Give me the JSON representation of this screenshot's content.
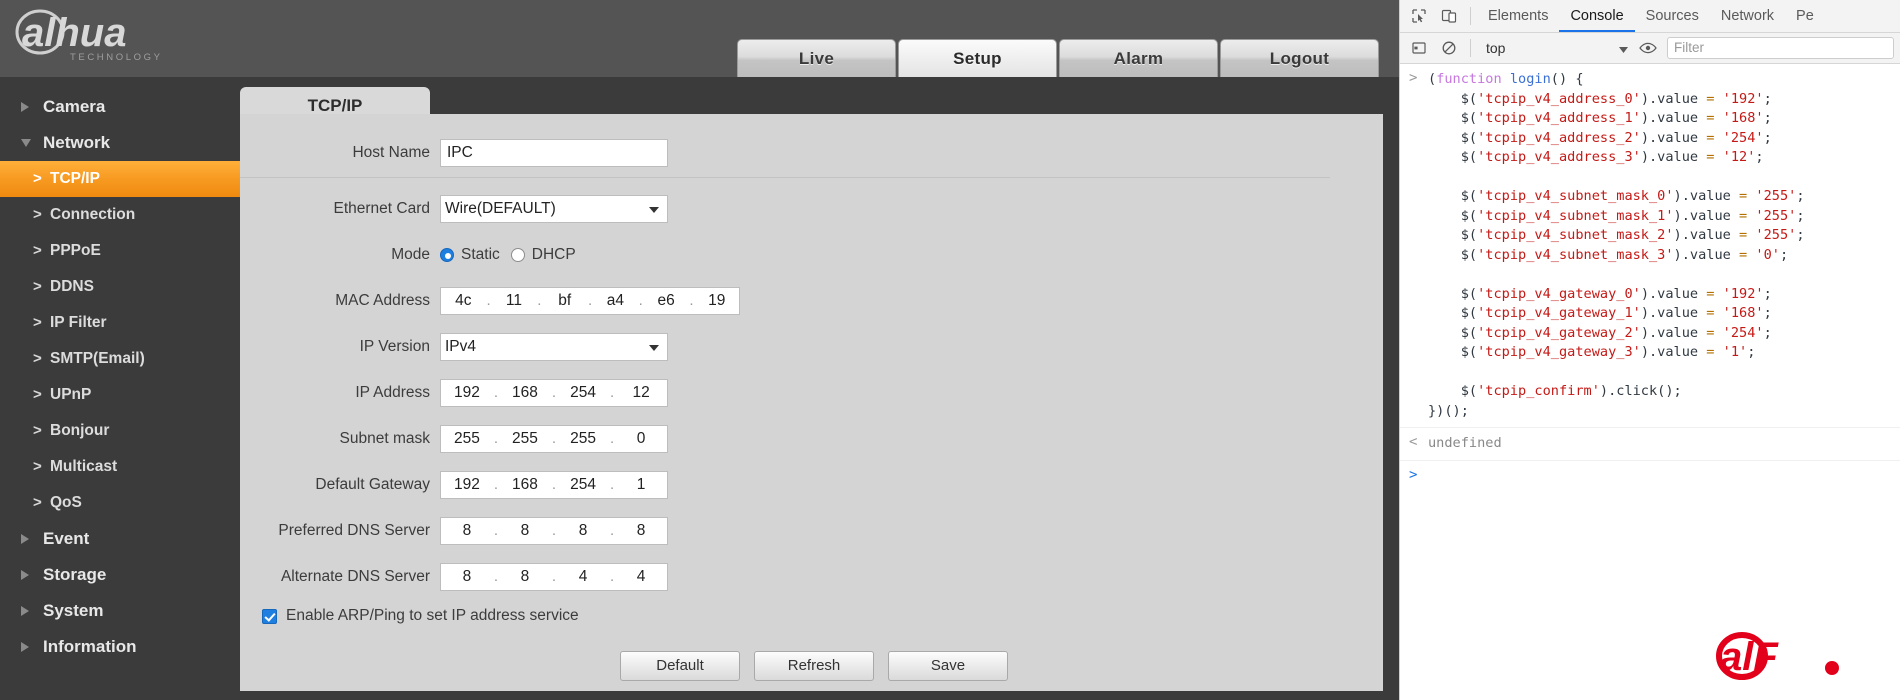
{
  "brand": {
    "logo_text": "alhua",
    "logo_sub": "TECHNOLOGY"
  },
  "header": {
    "tabs": [
      {
        "label": "Live",
        "active": false
      },
      {
        "label": "Setup",
        "active": true
      },
      {
        "label": "Alarm",
        "active": false
      },
      {
        "label": "Logout",
        "active": false
      }
    ]
  },
  "sidebar": {
    "groups": [
      {
        "label": "Camera",
        "expanded": false
      },
      {
        "label": "Network",
        "expanded": true
      },
      {
        "label": "Event",
        "expanded": false
      },
      {
        "label": "Storage",
        "expanded": false
      },
      {
        "label": "System",
        "expanded": false
      },
      {
        "label": "Information",
        "expanded": false
      }
    ],
    "network_items": [
      {
        "label": "TCP/IP",
        "active": true
      },
      {
        "label": "Connection",
        "active": false
      },
      {
        "label": "PPPoE",
        "active": false
      },
      {
        "label": "DDNS",
        "active": false
      },
      {
        "label": "IP Filter",
        "active": false
      },
      {
        "label": "SMTP(Email)",
        "active": false
      },
      {
        "label": "UPnP",
        "active": false
      },
      {
        "label": "Bonjour",
        "active": false
      },
      {
        "label": "Multicast",
        "active": false
      },
      {
        "label": "QoS",
        "active": false
      }
    ]
  },
  "panel": {
    "tab_label": "TCP/IP",
    "labels": {
      "host_name": "Host Name",
      "ethernet_card": "Ethernet Card",
      "mode": "Mode",
      "mac_address": "MAC Address",
      "ip_version": "IP Version",
      "ip_address": "IP Address",
      "subnet_mask": "Subnet mask",
      "default_gateway": "Default Gateway",
      "preferred_dns": "Preferred DNS Server",
      "alternate_dns": "Alternate DNS Server"
    },
    "values": {
      "host_name": "IPC",
      "ethernet_card": "Wire(DEFAULT)",
      "ip_version": "IPv4",
      "mac_address": [
        "4c",
        "11",
        "bf",
        "a4",
        "e6",
        "19"
      ],
      "ip_address": [
        "192",
        "168",
        "254",
        "12"
      ],
      "subnet_mask": [
        "255",
        "255",
        "255",
        "0"
      ],
      "default_gateway": [
        "192",
        "168",
        "254",
        "1"
      ],
      "preferred_dns": [
        "8",
        "8",
        "8",
        "8"
      ],
      "alternate_dns": [
        "8",
        "8",
        "4",
        "4"
      ]
    },
    "mode": {
      "static_label": "Static",
      "dhcp_label": "DHCP",
      "selected": "Static"
    },
    "arp_ping": {
      "label": "Enable ARP/Ping to set IP address service",
      "checked": true
    },
    "buttons": [
      {
        "label": "Default"
      },
      {
        "label": "Refresh"
      },
      {
        "label": "Save"
      }
    ]
  },
  "devtools": {
    "toolbar_icons": [
      "inspect-element-icon",
      "device-toolbar-icon"
    ],
    "tabs": [
      {
        "label": "Elements",
        "active": false
      },
      {
        "label": "Console",
        "active": true
      },
      {
        "label": "Sources",
        "active": false
      },
      {
        "label": "Network",
        "active": false
      },
      {
        "label": "Pe",
        "active": false
      }
    ],
    "subbar": {
      "sidebar_icon": "console-sidebar-icon",
      "clear_icon": "clear-console-icon",
      "context": "top",
      "eye_icon": "live-expression-icon",
      "filter_placeholder": "Filter"
    },
    "console": {
      "input_prompt": ">",
      "output_prompt": "<",
      "result": "undefined",
      "code_lines": [
        {
          "indent": 0,
          "tokens": [
            {
              "t": "(",
              "c": "plain"
            },
            {
              "t": "function ",
              "c": "kw"
            },
            {
              "t": "login",
              "c": "fn"
            },
            {
              "t": "() {",
              "c": "plain"
            }
          ]
        },
        {
          "indent": 1,
          "tokens": [
            {
              "t": "$(",
              "c": "plain"
            },
            {
              "t": "'tcpip_v4_address_0'",
              "c": "str"
            },
            {
              "t": ").value ",
              "c": "plain"
            },
            {
              "t": "=",
              "c": "op"
            },
            {
              "t": " ",
              "c": "plain"
            },
            {
              "t": "'192'",
              "c": "str"
            },
            {
              "t": ";",
              "c": "plain"
            }
          ]
        },
        {
          "indent": 1,
          "tokens": [
            {
              "t": "$(",
              "c": "plain"
            },
            {
              "t": "'tcpip_v4_address_1'",
              "c": "str"
            },
            {
              "t": ").value ",
              "c": "plain"
            },
            {
              "t": "=",
              "c": "op"
            },
            {
              "t": " ",
              "c": "plain"
            },
            {
              "t": "'168'",
              "c": "str"
            },
            {
              "t": ";",
              "c": "plain"
            }
          ]
        },
        {
          "indent": 1,
          "tokens": [
            {
              "t": "$(",
              "c": "plain"
            },
            {
              "t": "'tcpip_v4_address_2'",
              "c": "str"
            },
            {
              "t": ").value ",
              "c": "plain"
            },
            {
              "t": "=",
              "c": "op"
            },
            {
              "t": " ",
              "c": "plain"
            },
            {
              "t": "'254'",
              "c": "str"
            },
            {
              "t": ";",
              "c": "plain"
            }
          ]
        },
        {
          "indent": 1,
          "tokens": [
            {
              "t": "$(",
              "c": "plain"
            },
            {
              "t": "'tcpip_v4_address_3'",
              "c": "str"
            },
            {
              "t": ").value ",
              "c": "plain"
            },
            {
              "t": "=",
              "c": "op"
            },
            {
              "t": " ",
              "c": "plain"
            },
            {
              "t": "'12'",
              "c": "str"
            },
            {
              "t": ";",
              "c": "plain"
            }
          ]
        },
        {
          "indent": 0,
          "tokens": [
            {
              "t": "",
              "c": "plain"
            }
          ]
        },
        {
          "indent": 1,
          "tokens": [
            {
              "t": "$(",
              "c": "plain"
            },
            {
              "t": "'tcpip_v4_subnet_mask_0'",
              "c": "str"
            },
            {
              "t": ").value ",
              "c": "plain"
            },
            {
              "t": "=",
              "c": "op"
            },
            {
              "t": " ",
              "c": "plain"
            },
            {
              "t": "'255'",
              "c": "str"
            },
            {
              "t": ";",
              "c": "plain"
            }
          ]
        },
        {
          "indent": 1,
          "tokens": [
            {
              "t": "$(",
              "c": "plain"
            },
            {
              "t": "'tcpip_v4_subnet_mask_1'",
              "c": "str"
            },
            {
              "t": ").value ",
              "c": "plain"
            },
            {
              "t": "=",
              "c": "op"
            },
            {
              "t": " ",
              "c": "plain"
            },
            {
              "t": "'255'",
              "c": "str"
            },
            {
              "t": ";",
              "c": "plain"
            }
          ]
        },
        {
          "indent": 1,
          "tokens": [
            {
              "t": "$(",
              "c": "plain"
            },
            {
              "t": "'tcpip_v4_subnet_mask_2'",
              "c": "str"
            },
            {
              "t": ").value ",
              "c": "plain"
            },
            {
              "t": "=",
              "c": "op"
            },
            {
              "t": " ",
              "c": "plain"
            },
            {
              "t": "'255'",
              "c": "str"
            },
            {
              "t": ";",
              "c": "plain"
            }
          ]
        },
        {
          "indent": 1,
          "tokens": [
            {
              "t": "$(",
              "c": "plain"
            },
            {
              "t": "'tcpip_v4_subnet_mask_3'",
              "c": "str"
            },
            {
              "t": ").value ",
              "c": "plain"
            },
            {
              "t": "=",
              "c": "op"
            },
            {
              "t": " ",
              "c": "plain"
            },
            {
              "t": "'0'",
              "c": "str"
            },
            {
              "t": ";",
              "c": "plain"
            }
          ]
        },
        {
          "indent": 0,
          "tokens": [
            {
              "t": "",
              "c": "plain"
            }
          ]
        },
        {
          "indent": 1,
          "tokens": [
            {
              "t": "$(",
              "c": "plain"
            },
            {
              "t": "'tcpip_v4_gateway_0'",
              "c": "str"
            },
            {
              "t": ").value ",
              "c": "plain"
            },
            {
              "t": "=",
              "c": "op"
            },
            {
              "t": " ",
              "c": "plain"
            },
            {
              "t": "'192'",
              "c": "str"
            },
            {
              "t": ";",
              "c": "plain"
            }
          ]
        },
        {
          "indent": 1,
          "tokens": [
            {
              "t": "$(",
              "c": "plain"
            },
            {
              "t": "'tcpip_v4_gateway_1'",
              "c": "str"
            },
            {
              "t": ").value ",
              "c": "plain"
            },
            {
              "t": "=",
              "c": "op"
            },
            {
              "t": " ",
              "c": "plain"
            },
            {
              "t": "'168'",
              "c": "str"
            },
            {
              "t": ";",
              "c": "plain"
            }
          ]
        },
        {
          "indent": 1,
          "tokens": [
            {
              "t": "$(",
              "c": "plain"
            },
            {
              "t": "'tcpip_v4_gateway_2'",
              "c": "str"
            },
            {
              "t": ").value ",
              "c": "plain"
            },
            {
              "t": "=",
              "c": "op"
            },
            {
              "t": " ",
              "c": "plain"
            },
            {
              "t": "'254'",
              "c": "str"
            },
            {
              "t": ";",
              "c": "plain"
            }
          ]
        },
        {
          "indent": 1,
          "tokens": [
            {
              "t": "$(",
              "c": "plain"
            },
            {
              "t": "'tcpip_v4_gateway_3'",
              "c": "str"
            },
            {
              "t": ").value ",
              "c": "plain"
            },
            {
              "t": "=",
              "c": "op"
            },
            {
              "t": " ",
              "c": "plain"
            },
            {
              "t": "'1'",
              "c": "str"
            },
            {
              "t": ";",
              "c": "plain"
            }
          ]
        },
        {
          "indent": 0,
          "tokens": [
            {
              "t": "",
              "c": "plain"
            }
          ]
        },
        {
          "indent": 1,
          "tokens": [
            {
              "t": "$(",
              "c": "plain"
            },
            {
              "t": "'tcpip_confirm'",
              "c": "str"
            },
            {
              "t": ").click();",
              "c": "plain"
            }
          ]
        },
        {
          "indent": 0,
          "tokens": [
            {
              "t": "})();",
              "c": "plain"
            }
          ]
        }
      ]
    }
  },
  "colors": {
    "accent_orange": "#f79a22",
    "dark_bg": "#3b3b3b",
    "topbar": "#545454",
    "panel_bg": "#d4d4d4",
    "brand_red": "#e2001a",
    "devtools_blue": "#1a73e8"
  }
}
